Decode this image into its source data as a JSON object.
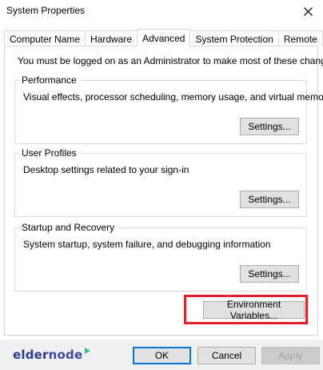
{
  "window": {
    "title": "System Properties",
    "close_glyph": "close-icon"
  },
  "tabs": [
    {
      "label": "Computer Name"
    },
    {
      "label": "Hardware"
    },
    {
      "label": "Advanced",
      "active": true
    },
    {
      "label": "System Protection"
    },
    {
      "label": "Remote"
    }
  ],
  "admin_note": "You must be logged on as an Administrator to make most of these changes.",
  "groups": {
    "performance": {
      "title": "Performance",
      "description": "Visual effects, processor scheduling, memory usage, and virtual memory",
      "button": "Settings..."
    },
    "user_profiles": {
      "title": "User Profiles",
      "description": "Desktop settings related to your sign-in",
      "button": "Settings..."
    },
    "startup_recovery": {
      "title": "Startup and Recovery",
      "description": "System startup, system failure, and debugging information",
      "button": "Settings..."
    }
  },
  "env_button": "Environment Variables...",
  "footer": {
    "ok": "OK",
    "cancel": "Cancel",
    "apply": "Apply"
  },
  "logo": {
    "part1": "elder",
    "part2": "node"
  },
  "colors": {
    "highlight": "#e2212f",
    "accent": "#0078d7",
    "logo": "#2b3a8a"
  }
}
